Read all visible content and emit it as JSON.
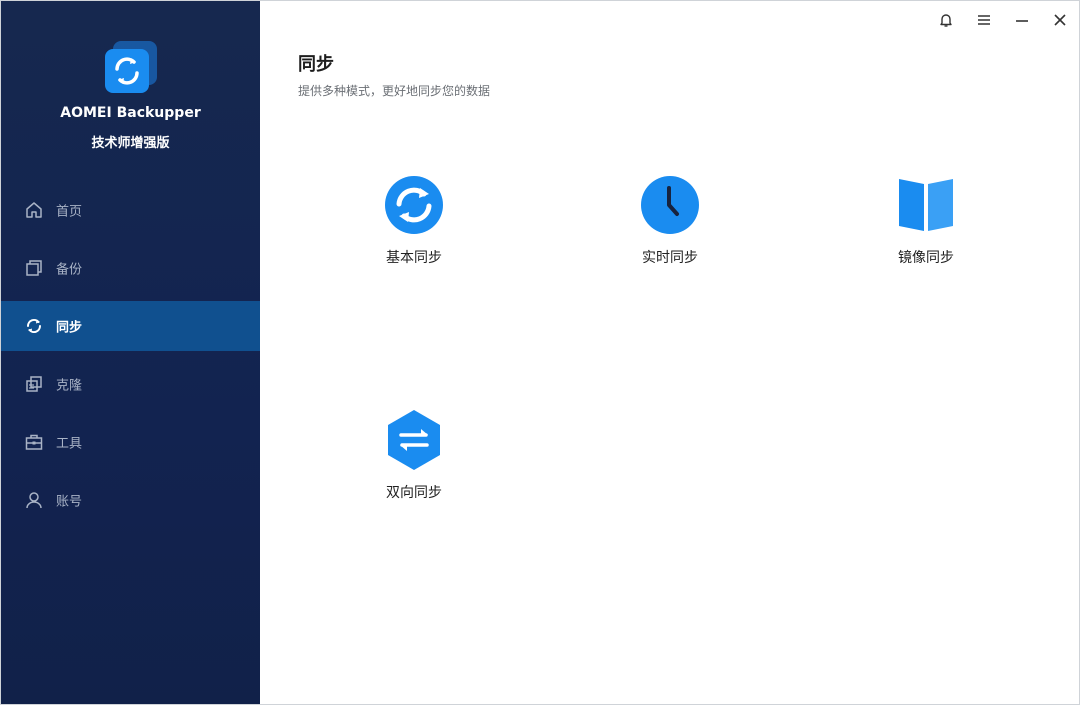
{
  "app": {
    "name": "AOMEI Backupper",
    "edition": "技术师增强版"
  },
  "sidebar": {
    "items": [
      {
        "label": "首页",
        "icon": "home-icon",
        "active": false
      },
      {
        "label": "备份",
        "icon": "backup-icon",
        "active": false
      },
      {
        "label": "同步",
        "icon": "sync-icon",
        "active": true
      },
      {
        "label": "克隆",
        "icon": "clone-icon",
        "active": false
      },
      {
        "label": "工具",
        "icon": "toolbox-icon",
        "active": false
      },
      {
        "label": "账号",
        "icon": "user-icon",
        "active": false
      }
    ]
  },
  "window_controls": [
    "bell-icon",
    "menu-icon",
    "minimize-icon",
    "close-icon"
  ],
  "main": {
    "title": "同步",
    "subtitle": "提供多种模式，更好地同步您的数据",
    "options": [
      {
        "label": "基本同步",
        "icon": "basic-sync-icon"
      },
      {
        "label": "实时同步",
        "icon": "realtime-sync-icon"
      },
      {
        "label": "镜像同步",
        "icon": "mirror-sync-icon"
      },
      {
        "label": "双向同步",
        "icon": "two-way-sync-icon"
      }
    ]
  },
  "colors": {
    "sidebar_bg": "#142650",
    "active_item_bg": "#10508f",
    "accent_blue": "#1a8cf0"
  }
}
